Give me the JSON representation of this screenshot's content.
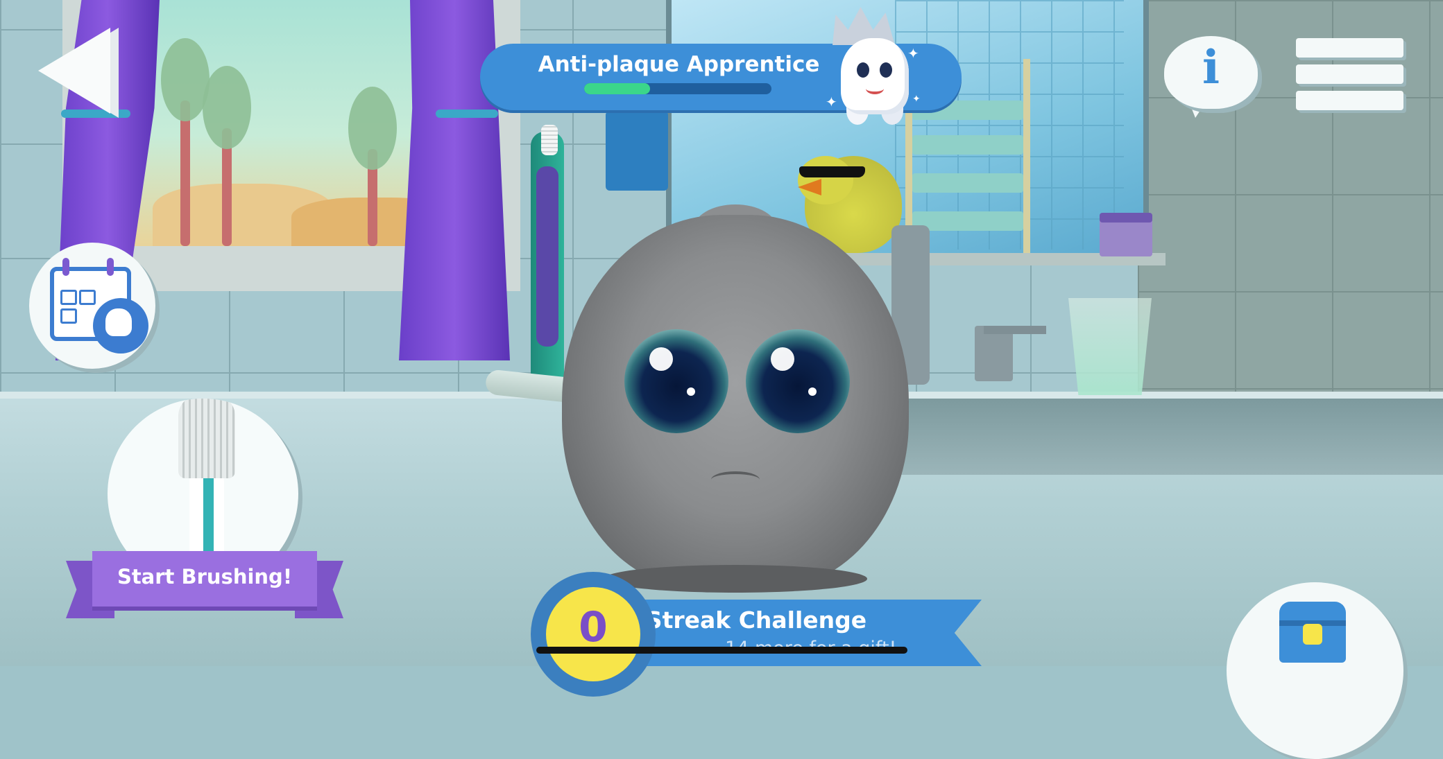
{
  "header": {
    "rank_title": "Anti-plaque Apprentice",
    "rank_progress": 0.35
  },
  "buttons": {
    "start_brushing_label": "Start Brushing!"
  },
  "streak": {
    "count": "0",
    "title": "Streak Challenge",
    "subtitle": "14 more for a gift!"
  },
  "icons": {
    "back": "back-arrow-icon",
    "info": "i",
    "menu": "hamburger-menu-icon",
    "calendar": "calendar-tooth-badge-icon",
    "brush": "toothbrush-icon",
    "chest": "treasure-chest-icon",
    "mascot": "crowned-tooth-icon"
  },
  "colors": {
    "banner_blue": "#3d8fd8",
    "progress_green": "#3bd68a",
    "ribbon_purple": "#9a6fe0",
    "streak_yellow": "#f7e54a"
  }
}
